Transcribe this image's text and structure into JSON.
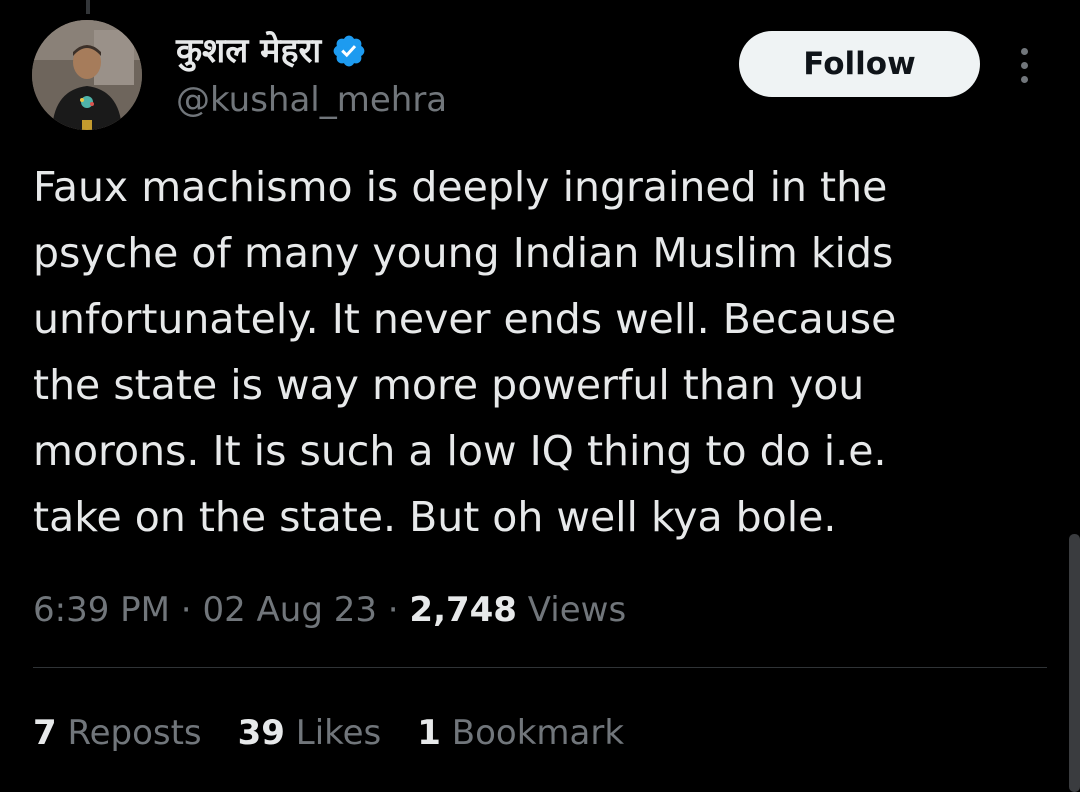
{
  "author": {
    "display_name": "कुशल मेहरा",
    "handle": "@kushal_mehra",
    "verified": true,
    "avatar_icon": "profile-photo"
  },
  "header": {
    "follow_label": "Follow",
    "more_icon": "more-options-icon"
  },
  "tweet": {
    "lines": [
      "Faux machismo is deeply ingrained in the",
      "psyche of many young Indian Muslim kids",
      "unfortunately. It never ends well. Because",
      "the state is way more powerful than you",
      "morons. It is such a low IQ thing to do i.e.",
      "take on the state. But oh well kya bole."
    ]
  },
  "meta": {
    "time": "6:39 PM",
    "separator1": " · ",
    "date": "02 Aug 23",
    "separator2": " · ",
    "views_count": "2,748",
    "views_label": " Views"
  },
  "stats": {
    "reposts_count": "7",
    "reposts_label": " Reposts",
    "likes_count": "39",
    "likes_label": " Likes",
    "bookmarks_count": "1",
    "bookmarks_label": " Bookmark"
  },
  "colors": {
    "background": "#000000",
    "text": "#e7e9ea",
    "secondary_text": "#71767b",
    "verified_blue": "#1d9bf0",
    "follow_bg": "#eff3f4"
  }
}
